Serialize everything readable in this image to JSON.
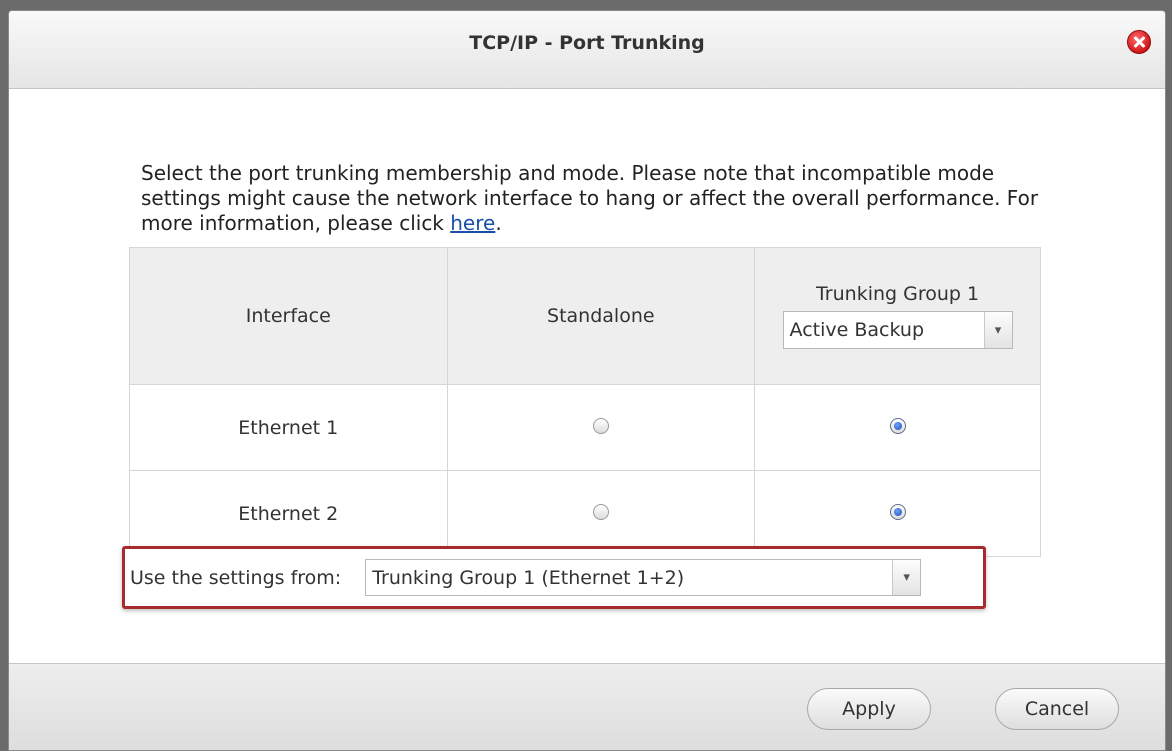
{
  "dialog": {
    "title": "TCP/IP - Port Trunking",
    "close_icon": "close-icon"
  },
  "description": {
    "text": "Select the port trunking membership and mode. Please note that incompatible mode settings might cause the network interface to hang or affect the overall performance. For more information, please click ",
    "link_text": "here",
    "trailing": "."
  },
  "table": {
    "headers": {
      "interface": "Interface",
      "standalone": "Standalone",
      "group": "Trunking Group 1"
    },
    "group_mode": "Active Backup",
    "rows": [
      {
        "interface": "Ethernet 1",
        "standalone_selected": false,
        "group_selected": true
      },
      {
        "interface": "Ethernet 2",
        "standalone_selected": false,
        "group_selected": true
      }
    ]
  },
  "settings": {
    "label": "Use the settings from:",
    "value": "Trunking Group 1 (Ethernet 1+2)",
    "highlight_color": "#a62a2e"
  },
  "footer": {
    "apply_label": "Apply",
    "cancel_label": "Cancel"
  }
}
